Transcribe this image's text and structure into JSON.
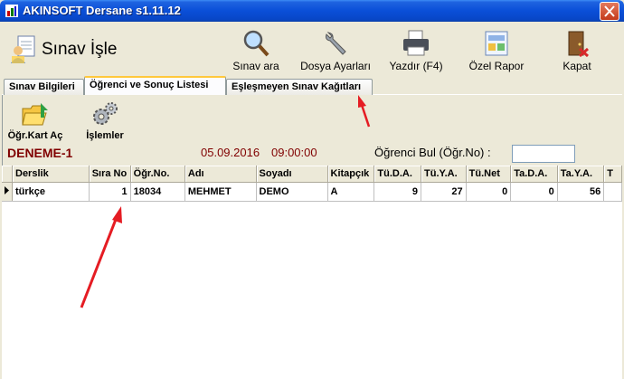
{
  "window": {
    "title": "AKINSOFT Dersane s1.11.12"
  },
  "header": {
    "title": "Sınav İşle"
  },
  "toolbar": {
    "search_label": "Sınav ara",
    "file_settings_label": "Dosya Ayarları",
    "print_label": "Yazdır (F4)",
    "report_label": "Özel Rapor",
    "close_label": "Kapat"
  },
  "tabs": [
    {
      "label": "Sınav Bilgileri"
    },
    {
      "label": "Öğrenci ve Sonuç Listesi"
    },
    {
      "label": "Eşleşmeyen Sınav Kağıtları"
    }
  ],
  "subtoolbar": {
    "open_card_label": "Öğr.Kart Aç",
    "operations_label": "İşlemler"
  },
  "exam": {
    "name": "DENEME-1",
    "date": "05.09.2016",
    "time": "09:00:00",
    "find_label": "Öğrenci Bul (Öğr.No) :",
    "find_value": ""
  },
  "grid": {
    "columns": [
      "Derslik",
      "Sıra No",
      "Öğr.No.",
      "Adı",
      "Soyadı",
      "Kitapçık",
      "Tü.D.A.",
      "Tü.Y.A.",
      "Tü.Net",
      "Ta.D.A.",
      "Ta.Y.A.",
      "T"
    ],
    "rows": [
      [
        "türkçe",
        "1",
        "18034",
        "MEHMET",
        "DEMO",
        "A",
        "9",
        "27",
        "0",
        "0",
        "56",
        ""
      ]
    ]
  },
  "colors": {
    "annotation_arrow": "#e51c23",
    "exam_text": "#800000"
  }
}
